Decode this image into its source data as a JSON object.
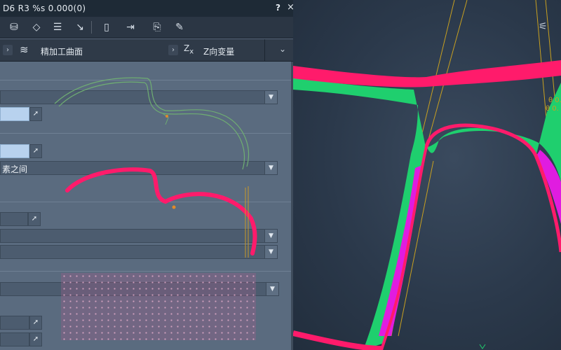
{
  "window": {
    "title": "D6 R3 %s 0.000(0)",
    "help_label": "?",
    "close_label": "×"
  },
  "toolbar": {
    "icons": [
      "tool-db-icon",
      "surface-icon",
      "list-icon",
      "move-icon",
      "panel-icon",
      "insert-icon",
      "export-icon",
      "edit-icon"
    ]
  },
  "subbar": {
    "left_label": "精加工曲面",
    "right_label": "Z向变量",
    "z_prefix": "Z",
    "z_sub": "x"
  },
  "form": {
    "row2_dropdown_text": "素之间"
  },
  "colors": {
    "panel": "#5a6b7f",
    "titlebar": "#1e2a36",
    "frame_pink": "#ff1b6b",
    "frame_green": "#1fcf6e",
    "frame_magenta": "#e01ce0",
    "toolpath_yellow": "#c8a020"
  }
}
